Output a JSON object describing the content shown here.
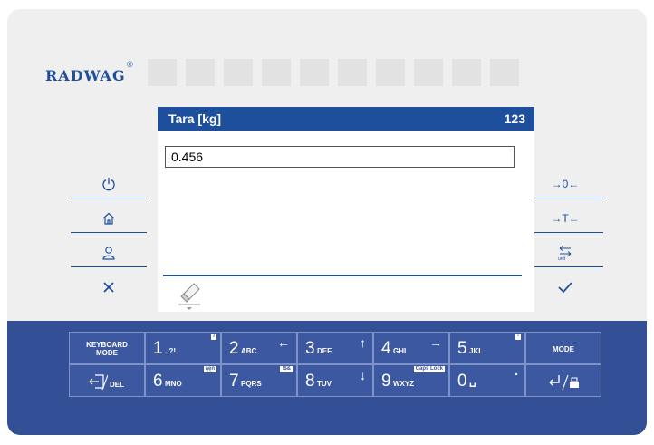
{
  "brand": {
    "logo_text": "RADWAG",
    "registered": "®"
  },
  "dialog": {
    "title": "Tara [kg]",
    "input_mode": "123",
    "input_value": "0.456"
  },
  "left_keys": [
    {
      "name": "power-icon",
      "glyph": "⏻"
    },
    {
      "name": "home-icon",
      "glyph": "⌂"
    },
    {
      "name": "user-icon",
      "glyph": "♙"
    },
    {
      "name": "cancel-icon",
      "glyph": "✕"
    }
  ],
  "right_keys": [
    {
      "name": "zero-icon",
      "label": "→0←"
    },
    {
      "name": "tare-icon",
      "label": "→T←"
    },
    {
      "name": "unit-icon",
      "label": "unit"
    },
    {
      "name": "confirm-icon",
      "glyph": "✓"
    }
  ],
  "keypad": {
    "keyboard_mode": [
      "KEYBOARD",
      "MODE"
    ],
    "k1": {
      "digit": "1",
      "letters": ".,?!",
      "ext": "/"
    },
    "k2": {
      "digit": "2",
      "letters": "ABC",
      "arrow": "←"
    },
    "k3": {
      "digit": "3",
      "letters": "DEF",
      "arrow": "↑"
    },
    "k4": {
      "digit": "4",
      "letters": "GHI",
      "arrow": "→"
    },
    "k5": {
      "digit": "5",
      "letters": "JKL",
      "ext": "-"
    },
    "mode": "MODE",
    "del": "DEL",
    "k6": {
      "digit": "6",
      "letters": "MNO",
      "ext": "ąęń"
    },
    "k7": {
      "digit": "7",
      "letters": "PQRS",
      "ext": "!$&"
    },
    "k8": {
      "digit": "8",
      "letters": "TUV",
      "arrow": "↓"
    },
    "k9": {
      "digit": "9",
      "letters": "WXYZ",
      "ext": "Caps Lock"
    },
    "k0": {
      "digit": "0",
      "letters": "␣",
      "ext": "."
    }
  },
  "colors": {
    "accent": "#1e4f9c",
    "keypad": "#334f96",
    "panel": "#efeff0"
  }
}
